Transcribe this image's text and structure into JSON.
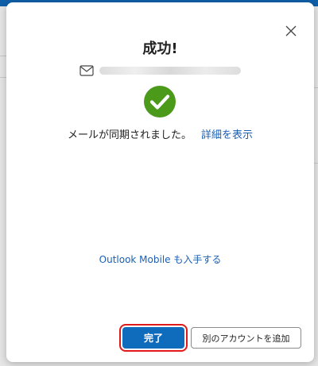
{
  "dialog": {
    "title": "成功!",
    "sync_message": "メールが同期されました。",
    "details_link": "詳細を表示",
    "outlook_mobile_link": "Outlook Mobile も入手する",
    "done_button": "完了",
    "add_account_button": "別のアカウントを追加"
  },
  "icons": {
    "close": "close-icon",
    "mail": "mail-icon",
    "success": "check-circle-icon"
  },
  "colors": {
    "success_green": "#4c9a1a",
    "link_blue": "#1a5fb4",
    "primary_button": "#0f6cbd",
    "highlight_red": "#e0191b",
    "header_blue": "#0f5fa8"
  }
}
